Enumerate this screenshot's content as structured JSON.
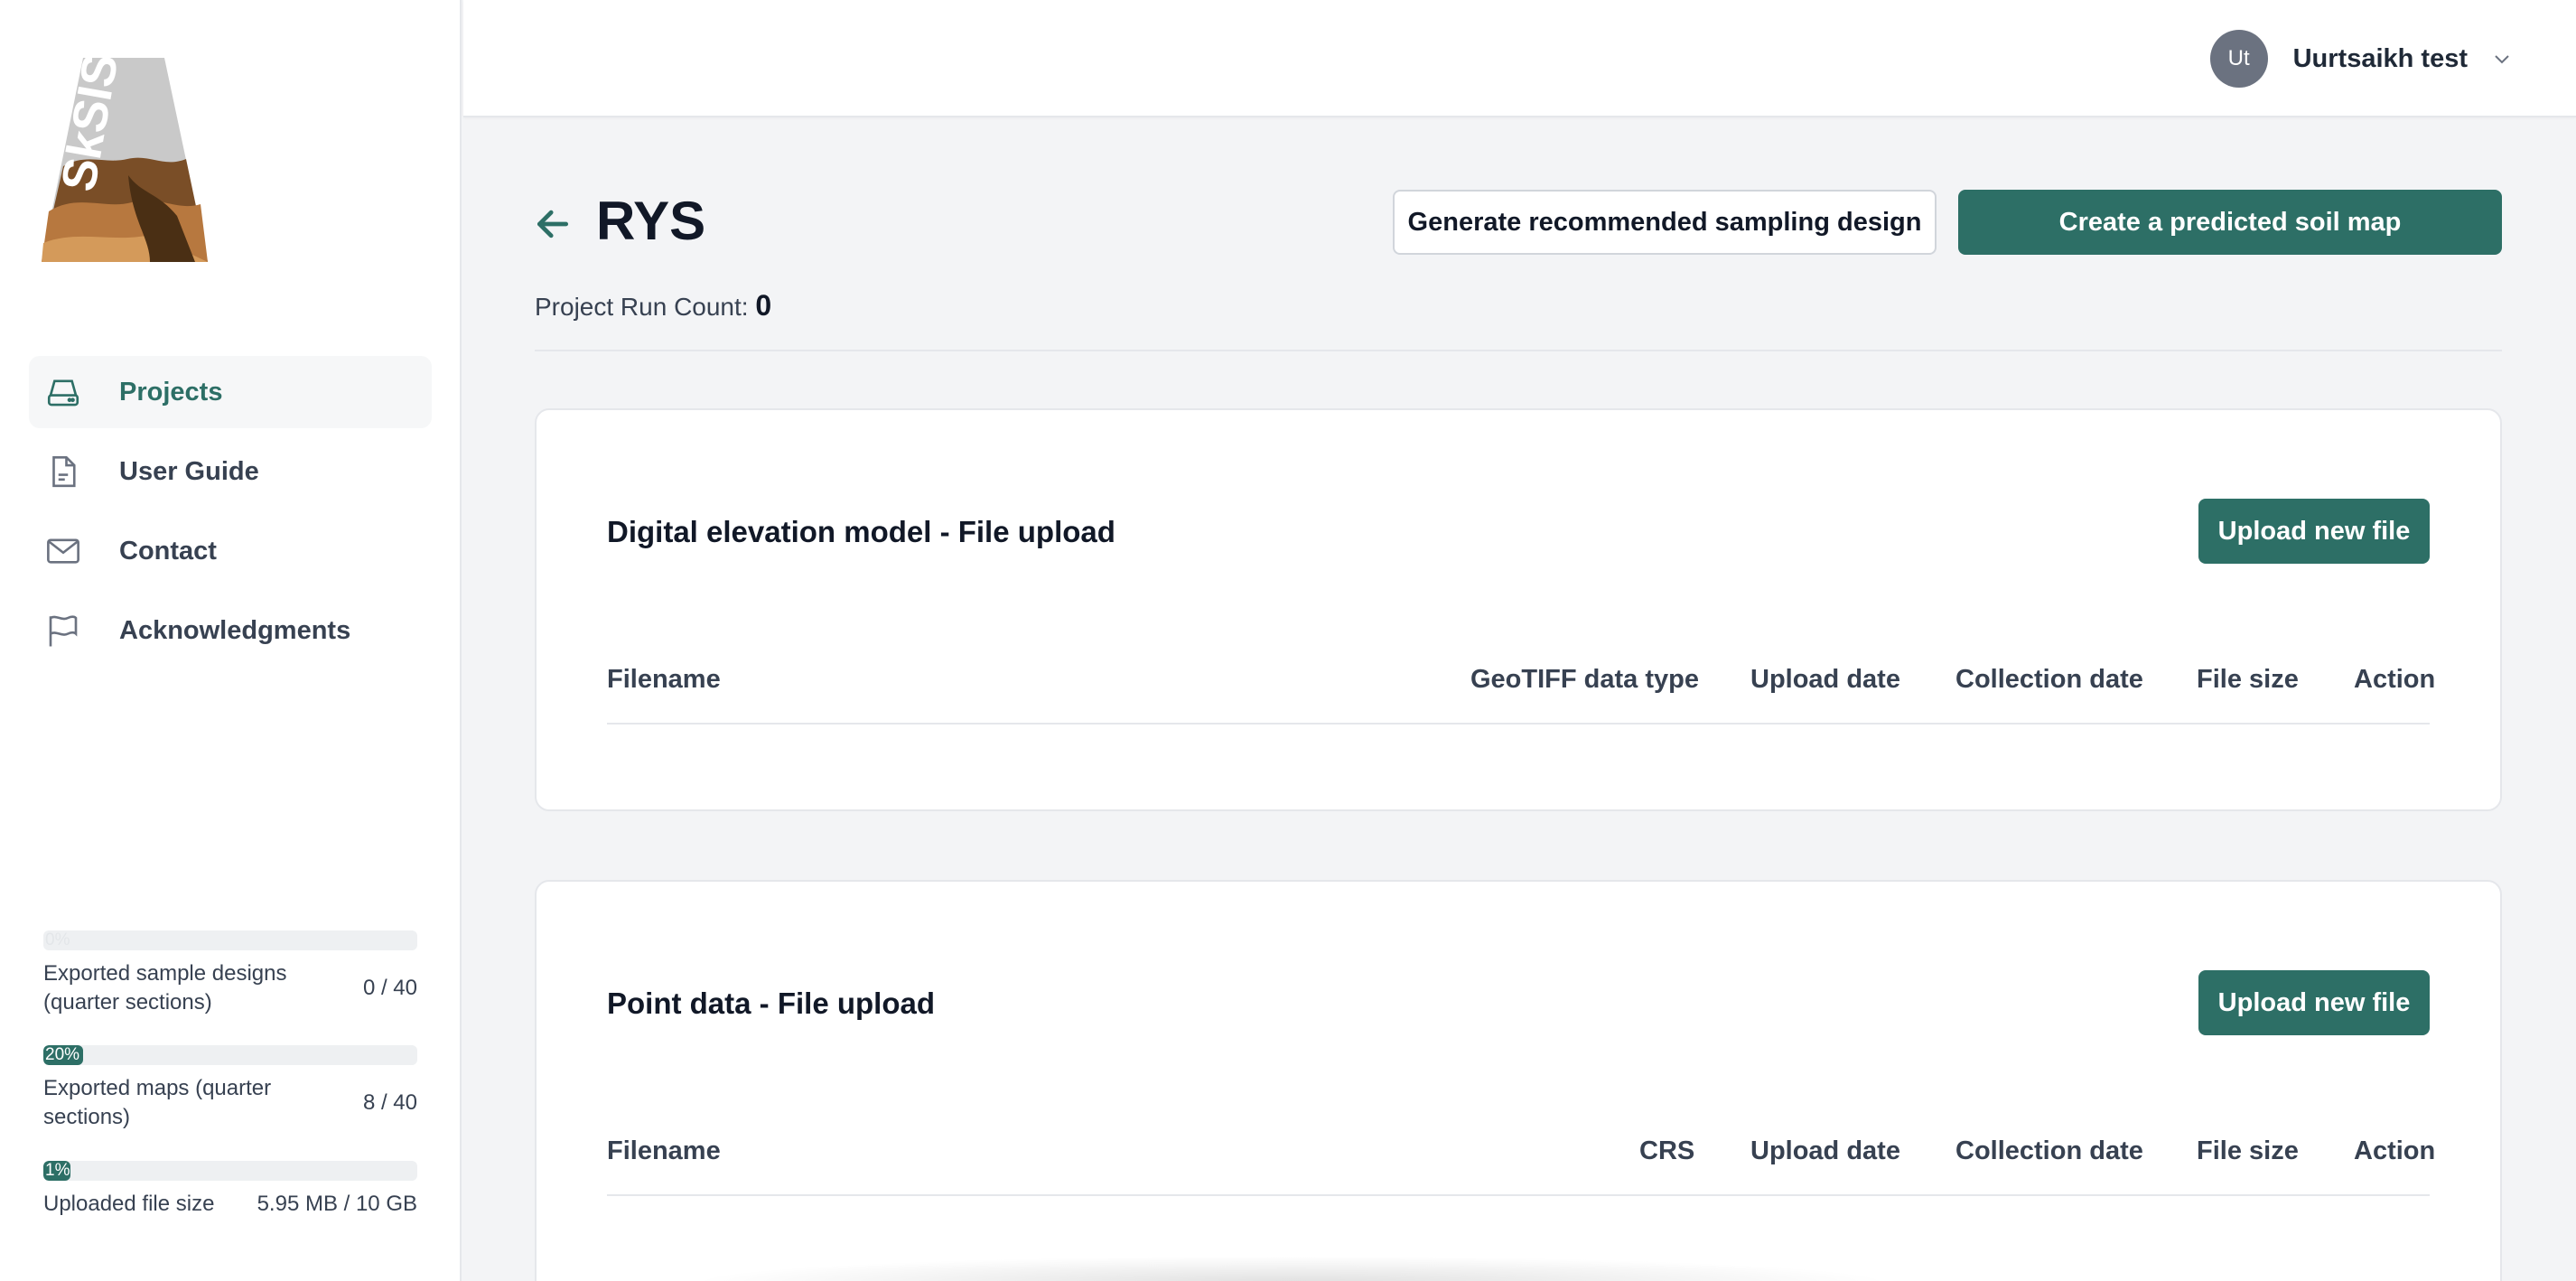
{
  "sidebar": {
    "logo_text": "SkSIS",
    "nav": [
      {
        "label": "Projects",
        "icon": "drive-icon",
        "active": true
      },
      {
        "label": "User Guide",
        "icon": "document-icon",
        "active": false
      },
      {
        "label": "Contact",
        "icon": "mail-icon",
        "active": false
      },
      {
        "label": "Acknowledgments",
        "icon": "flag-icon",
        "active": false
      }
    ],
    "usage": [
      {
        "percent_text": "0%",
        "percent": 0,
        "label": "Exported sample designs (quarter sections)",
        "value": "0 / 40"
      },
      {
        "percent_text": "20%",
        "percent": 20,
        "label": "Exported maps (quarter sections)",
        "value": "8 / 40"
      },
      {
        "percent_text": "1%",
        "percent": 1,
        "label": "Uploaded file size",
        "value": "5.95 MB / 10 GB"
      }
    ]
  },
  "header": {
    "user_initials": "Ut",
    "user_name": "Uurtsaikh test"
  },
  "page": {
    "title": "RYS",
    "run_count_label": "Project Run Count:",
    "run_count_value": "0",
    "generate_button": "Generate recommended sampling design",
    "create_button": "Create a predicted soil map"
  },
  "cards": [
    {
      "title": "Digital elevation model - File upload",
      "upload_button": "Upload new file",
      "columns": [
        "Filename",
        "GeoTIFF data type",
        "Upload date",
        "Collection date",
        "File size",
        "Action"
      ]
    },
    {
      "title": "Point data - File upload",
      "upload_button": "Upload new file",
      "columns": [
        "Filename",
        "CRS",
        "Upload date",
        "Collection date",
        "File size",
        "Action"
      ]
    }
  ],
  "colors": {
    "accent": "#2d6f66",
    "background": "#f3f4f6"
  }
}
